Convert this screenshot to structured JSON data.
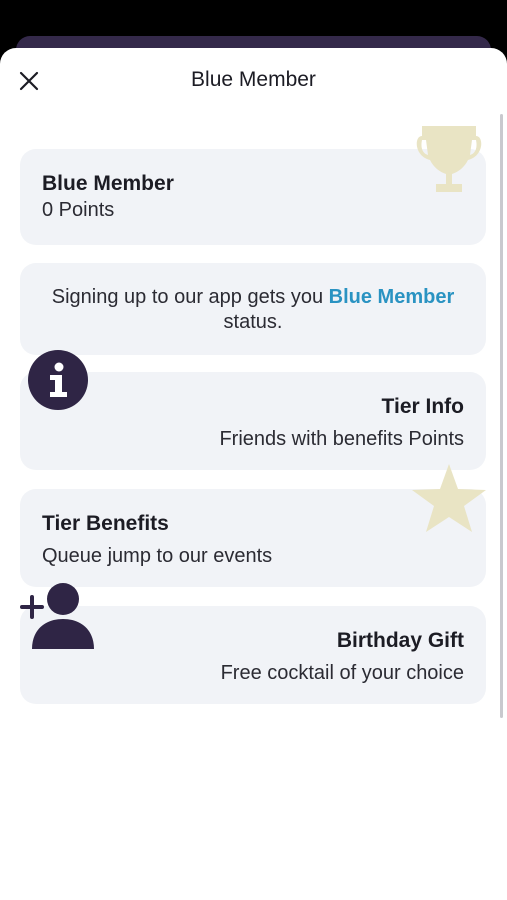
{
  "header": {
    "title": "Blue Member"
  },
  "membership": {
    "tier": "Blue Member",
    "points": "0 Points"
  },
  "signup": {
    "prefix": "Signing up to our app gets you ",
    "highlight": "Blue Member",
    "suffix": " status."
  },
  "cards": [
    {
      "title": "Tier Info",
      "subtitle": "Friends with benefits Points",
      "icon": "info-icon"
    },
    {
      "title": "Tier Benefits",
      "subtitle": "Queue jump to our events",
      "icon": "star-icon"
    },
    {
      "title": "Birthday Gift",
      "subtitle": "Free cocktail of your choice",
      "icon": "add-user-icon"
    }
  ],
  "decor": {
    "trophy_icon": "trophy-icon"
  },
  "colors": {
    "accent": "#2a93c2",
    "icon_dark": "#2f2545",
    "icon_gold": "#e9e4c4",
    "card_bg": "#f1f3f7"
  }
}
